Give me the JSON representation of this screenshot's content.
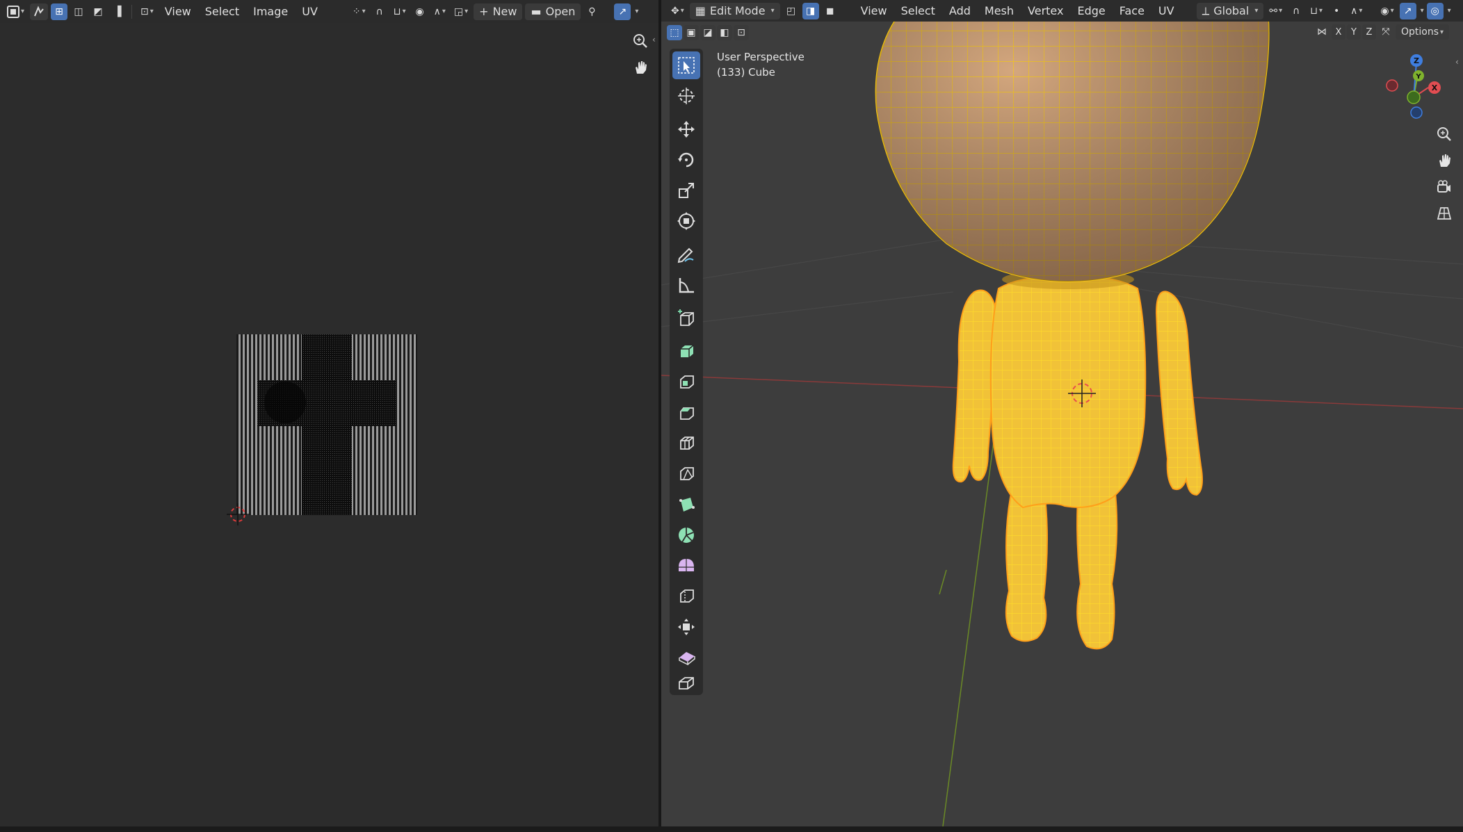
{
  "uv_editor": {
    "menus": [
      "View",
      "Select",
      "Image",
      "UV"
    ],
    "new_label": "New",
    "open_label": "Open"
  },
  "viewport": {
    "mode_label": "Edit Mode",
    "menus": [
      "View",
      "Select",
      "Add",
      "Mesh",
      "Vertex",
      "Edge",
      "Face",
      "UV"
    ],
    "orientation_label": "Global",
    "overlay_info": {
      "line1": "User Perspective",
      "line2": "(133) Cube"
    },
    "axis_toggles": [
      "X",
      "Y",
      "Z"
    ],
    "options_label": "Options",
    "gizmo": {
      "x": "X",
      "y": "Y",
      "z": "Z"
    }
  },
  "colors": {
    "accent": "#4772b3",
    "wire": "#f5c518",
    "mesh": "#c79566"
  },
  "tools": [
    "select-box",
    "cursor",
    "move",
    "rotate",
    "scale",
    "transform",
    "annotate",
    "measure",
    "add-cube",
    "extrude-region",
    "inset-faces",
    "bevel",
    "loop-cut",
    "knife",
    "poly-build",
    "spin",
    "smooth",
    "edge-slide",
    "shrink-fatten",
    "shear",
    "rip-region"
  ]
}
